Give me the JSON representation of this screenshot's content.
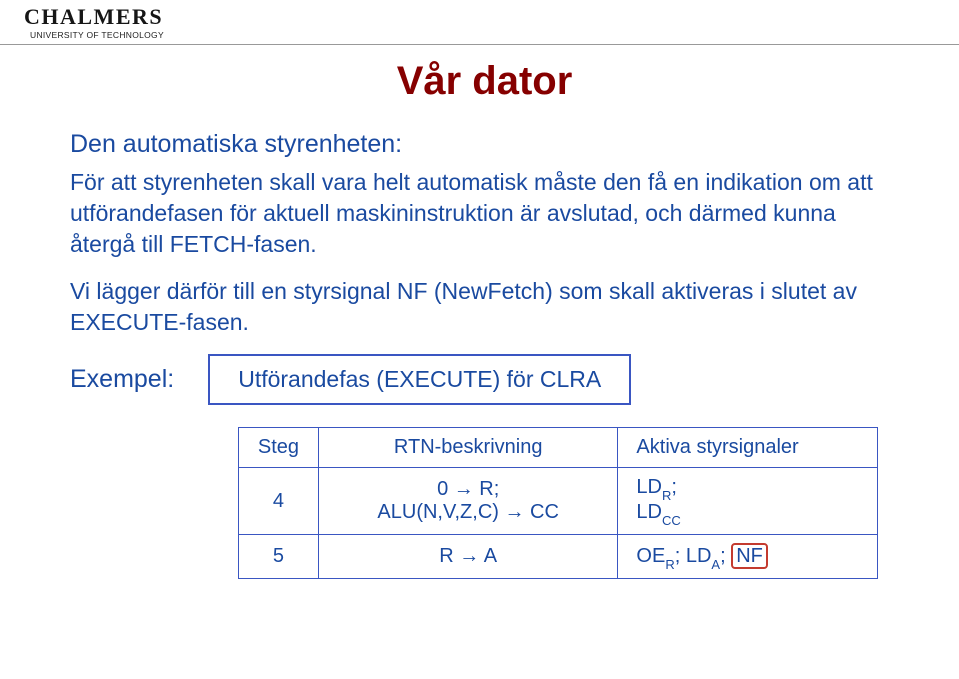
{
  "logo": {
    "main": "CHALMERS",
    "sub": "UNIVERSITY OF TECHNOLOGY"
  },
  "title": "Vår dator",
  "subtitle": "Den automatiska styrenheten:",
  "para1": "För att styrenheten skall vara helt automatisk måste den få en indikation om att utförandefasen för aktuell maskininstruktion är avslutad, och därmed kunna återgå till FETCH-fasen.",
  "para2": "Vi lägger därför till en styrsignal NF (NewFetch) som skall aktiveras i slutet av EXECUTE-fasen.",
  "example": {
    "label": "Exempel:",
    "caption": "Utförandefas (EXECUTE) för CLRA"
  },
  "table": {
    "headers": {
      "step": "Steg",
      "rtn": "RTN-beskrivning",
      "signals": "Aktiva styrsignaler"
    },
    "rows": [
      {
        "step": "4",
        "rtn_lines": [
          "0 → R;",
          "ALU(N,V,Z,C) → CC"
        ],
        "sig_parts": [
          {
            "text": "LD",
            "sub": "R",
            "suffix": ";"
          },
          {
            "br": true
          },
          {
            "text": "LD",
            "sub": "CC",
            "suffix": ""
          }
        ]
      },
      {
        "step": "5",
        "rtn_lines": [
          "R → A"
        ],
        "sig_parts": [
          {
            "text": "OE",
            "sub": "R",
            "suffix": "; "
          },
          {
            "text": "LD",
            "sub": "A",
            "suffix": "; "
          },
          {
            "nf": "NF"
          }
        ]
      }
    ]
  }
}
